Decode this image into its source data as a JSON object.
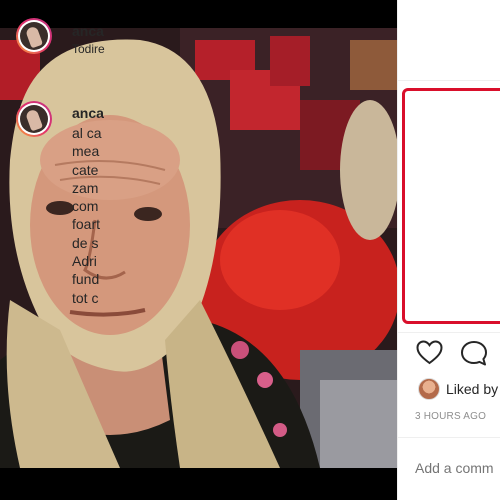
{
  "post": {
    "username": "anca",
    "location": "Todire",
    "caption": {
      "username": "anca",
      "lines": [
        "al ca",
        "mea",
        "cate",
        "zam",
        "com",
        "foart",
        "de s",
        "Adri",
        "fund",
        "tot c"
      ]
    },
    "liked_by_text": "Liked by",
    "timestamp": "3 HOURS AGO",
    "comment_placeholder": "Add a comm"
  },
  "colors": {
    "highlight_border": "#d90f2b",
    "story_ring": [
      "#f9a43a",
      "#e1306c",
      "#c13584"
    ],
    "muted_text": "#8e8e8e",
    "primary_text": "#262626"
  },
  "icons": [
    "heart-icon",
    "comment-icon"
  ]
}
